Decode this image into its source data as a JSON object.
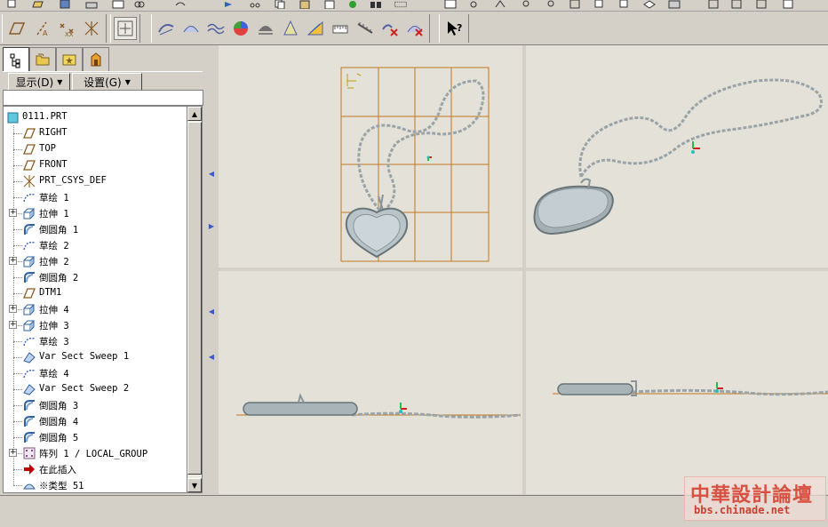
{
  "panel": {
    "menus": [
      {
        "label": "显示(D)"
      },
      {
        "label": "设置(G)"
      }
    ]
  },
  "tree": {
    "items": [
      {
        "label": "0111.PRT",
        "icon": "part-icon"
      },
      {
        "label": "RIGHT",
        "icon": "datum-plane-icon"
      },
      {
        "label": "TOP",
        "icon": "datum-plane-icon"
      },
      {
        "label": "FRONT",
        "icon": "datum-plane-icon"
      },
      {
        "label": "PRT_CSYS_DEF",
        "icon": "csys-icon"
      },
      {
        "label": "草绘 1",
        "icon": "sketch-icon"
      },
      {
        "label": "拉伸 1",
        "icon": "extrude-icon"
      },
      {
        "label": "倒圆角 1",
        "icon": "round-icon"
      },
      {
        "label": "草绘 2",
        "icon": "sketch-icon"
      },
      {
        "label": "拉伸 2",
        "icon": "extrude-icon"
      },
      {
        "label": "倒圆角 2",
        "icon": "round-icon"
      },
      {
        "label": "DTM1",
        "icon": "datum-plane-icon"
      },
      {
        "label": "拉伸 4",
        "icon": "extrude-icon"
      },
      {
        "label": "拉伸 3",
        "icon": "extrude-icon"
      },
      {
        "label": "草绘 3",
        "icon": "sketch-icon"
      },
      {
        "label": "Var Sect Sweep 1",
        "icon": "sweep-icon"
      },
      {
        "label": "草绘 4",
        "icon": "sketch-icon"
      },
      {
        "label": "Var Sect Sweep 2",
        "icon": "sweep-icon"
      },
      {
        "label": "倒圆角 3",
        "icon": "round-icon"
      },
      {
        "label": "倒圆角 4",
        "icon": "round-icon"
      },
      {
        "label": "倒圆角 5",
        "icon": "round-icon"
      },
      {
        "label": "阵列 1 / LOCAL_GROUP",
        "icon": "pattern-icon"
      },
      {
        "label": "在此插入",
        "icon": "insert-here-arrow-icon"
      },
      {
        "label": "※类型 51",
        "icon": "type-icon"
      }
    ]
  },
  "watermark": {
    "cn": "中華設計論壇",
    "url": "bbs.chinade.net"
  },
  "colors": {
    "accent": "#3a5ac8",
    "grid": "#c07820",
    "model": "#b8c4c8",
    "insert_arrow": "#c00000"
  }
}
